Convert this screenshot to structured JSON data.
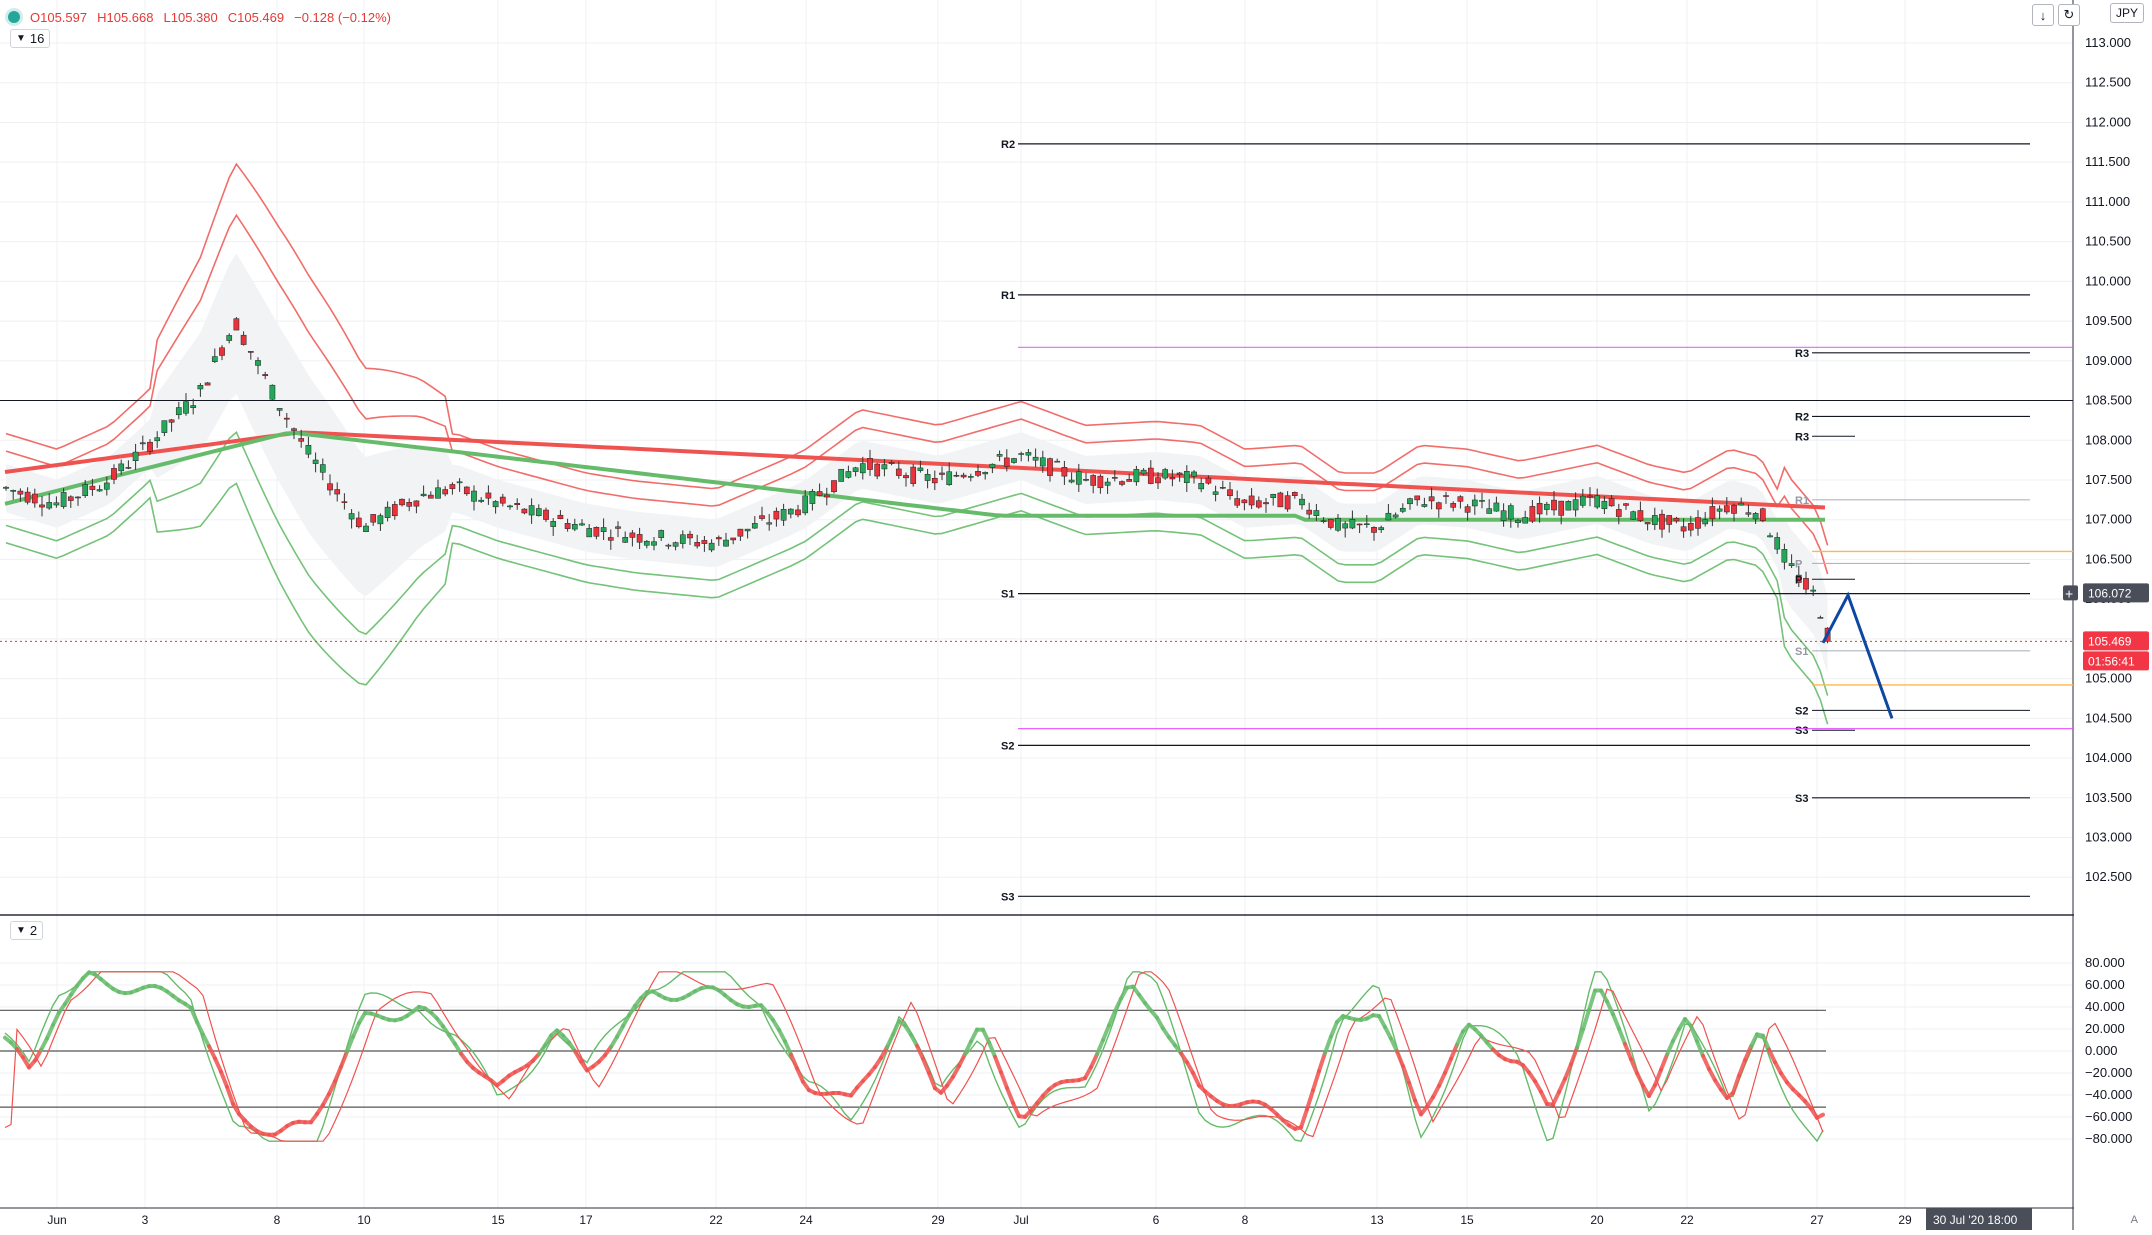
{
  "legend": {
    "open": "O105.597",
    "high": "H105.668",
    "low": "L105.380",
    "close": "C105.469",
    "change": "−0.128 (−0.12%)"
  },
  "main_pane": {
    "collapsed_count": "16"
  },
  "osc_pane": {
    "collapsed_count": "2"
  },
  "currency": "JPY",
  "price_axis": {
    "ticks": [
      "113.000",
      "112.500",
      "112.000",
      "111.500",
      "111.000",
      "110.500",
      "110.000",
      "109.500",
      "109.000",
      "108.500",
      "108.000",
      "107.500",
      "107.000",
      "106.500",
      "106.000",
      "105.500",
      "105.000",
      "104.500",
      "104.000",
      "103.500",
      "103.000",
      "102.500"
    ],
    "current_price": "105.469",
    "countdown": "01:56:41",
    "crosshair_price": "106.072"
  },
  "osc_axis": {
    "ticks": [
      "80.000",
      "60.000",
      "40.000",
      "20.000",
      "0.000",
      "−20.000",
      "−40.000",
      "−60.000",
      "−80.000"
    ]
  },
  "time_axis": {
    "ticks": [
      "Jun",
      "3",
      "8",
      "10",
      "15",
      "17",
      "22",
      "24",
      "29",
      "Jul",
      "6",
      "8",
      "13",
      "15",
      "20",
      "22",
      "27",
      "29"
    ],
    "crosshair_label": "30 Jul '20   18:00"
  },
  "pivot_labels": {
    "monthly": [
      "R2",
      "R1",
      "S1",
      "S2",
      "S3"
    ],
    "weekly": [
      "R3",
      "R2",
      "R1",
      "P",
      "S1",
      "S2",
      "S3"
    ],
    "daily": [
      "R3",
      "P",
      "S3"
    ]
  },
  "colors": {
    "up": "#26a65b",
    "down": "#e8323c",
    "ma_red": "#ef5350",
    "ma_green": "#66bb6a",
    "forecast": "#0d47a1",
    "magenta": "#e040fb",
    "orange": "#ffb74d"
  },
  "icons": [
    "download-icon",
    "refresh-icon",
    "add-icon"
  ],
  "scale_mode": "A"
}
